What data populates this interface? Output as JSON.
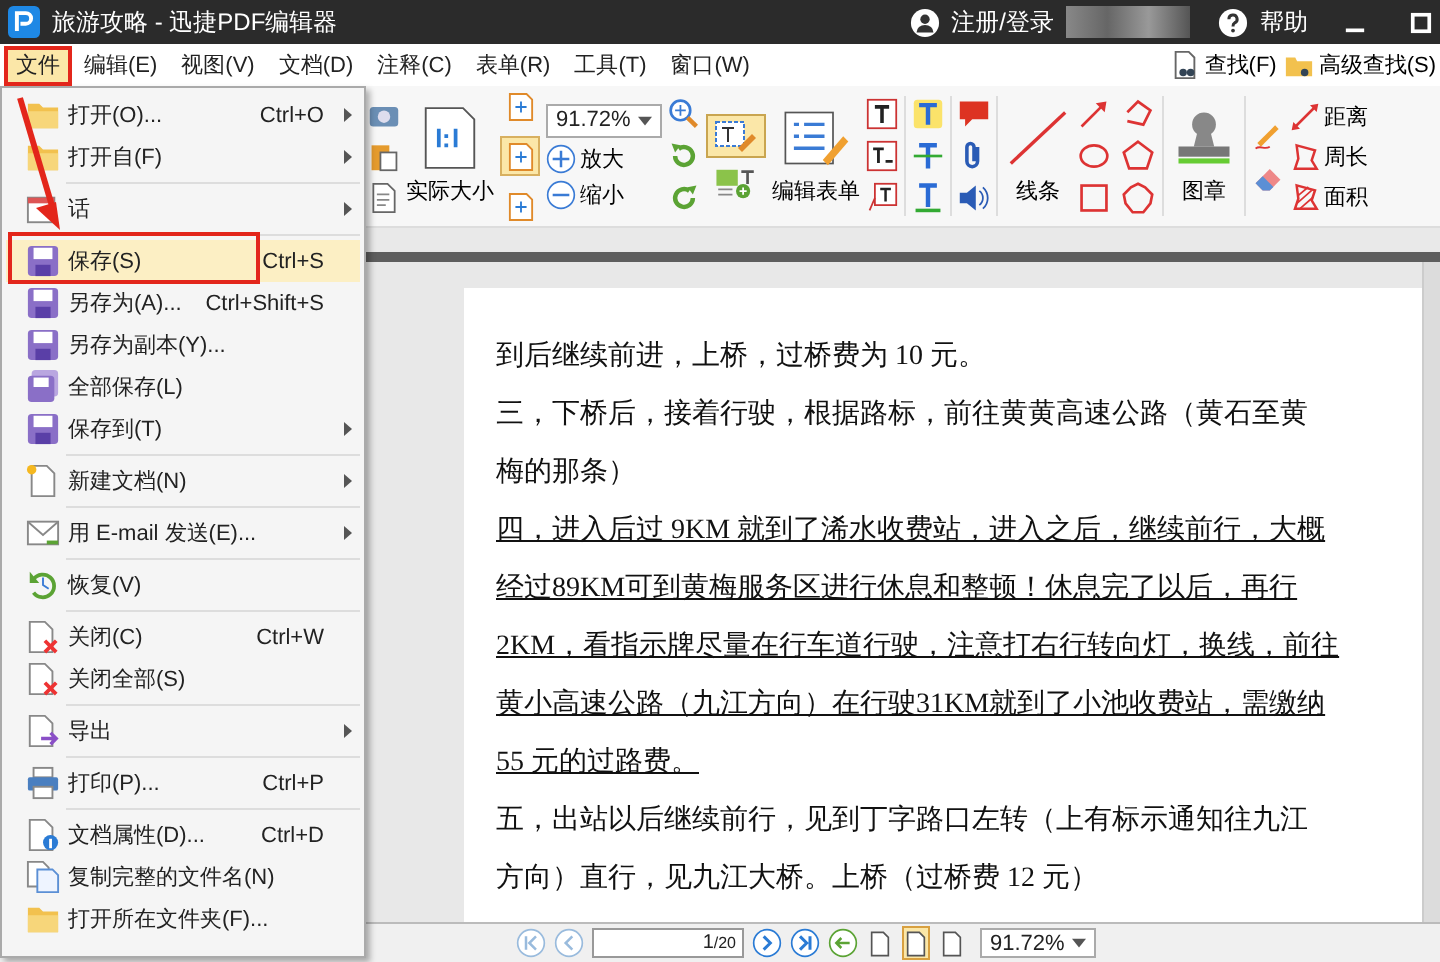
{
  "window": {
    "title": "旅游攻略 - 迅捷PDF编辑器",
    "login": "注册/登录",
    "help": "帮助"
  },
  "menubar": [
    {
      "label": "文件",
      "selected": true
    },
    {
      "label": "编辑(E)",
      "selected": false
    },
    {
      "label": "视图(V)",
      "selected": false
    },
    {
      "label": "文档(D)",
      "selected": false
    },
    {
      "label": "注释(C)",
      "selected": false
    },
    {
      "label": "表单(R)",
      "selected": false
    },
    {
      "label": "工具(T)",
      "selected": false
    },
    {
      "label": "窗口(W)",
      "selected": false
    }
  ],
  "search": {
    "find": "查找(F)",
    "advanced": "高级查找(S)"
  },
  "toolbar": {
    "actual_size": "实际大小",
    "zoom": "91.72%",
    "zoom_in": "放大",
    "zoom_out": "缩小",
    "fit_buttons": [
      {
        "selected": false
      },
      {
        "selected": true
      },
      {
        "selected": false
      }
    ],
    "edit_tool_selected": true,
    "edit_form": "编辑表单",
    "line": "线条",
    "stamp": "图章",
    "distance": "距离",
    "perimeter": "周长",
    "area": "面积"
  },
  "file_menu": [
    [
      {
        "label": "打开(O)...",
        "shortcut": "Ctrl+O",
        "submenu": true,
        "selected": false
      },
      {
        "label": "打开自(F)",
        "submenu": true,
        "selected": false
      }
    ],
    [
      {
        "label": "话",
        "submenu": true,
        "selected": false
      }
    ],
    [
      {
        "label": "保存(S)",
        "shortcut": "Ctrl+S",
        "submenu": false,
        "selected": true
      },
      {
        "label": "另存为(A)...",
        "shortcut": "Ctrl+Shift+S",
        "submenu": false,
        "selected": false
      },
      {
        "label": "另存为副本(Y)...",
        "submenu": false,
        "selected": false
      },
      {
        "label": "全部保存(L)",
        "submenu": false,
        "selected": false
      },
      {
        "label": "保存到(T)",
        "submenu": true,
        "selected": false
      }
    ],
    [
      {
        "label": "新建文档(N)",
        "submenu": true,
        "selected": false
      }
    ],
    [
      {
        "label": "用 E-mail 发送(E)...",
        "submenu": true,
        "selected": false
      }
    ],
    [
      {
        "label": "恢复(V)",
        "submenu": false,
        "selected": false
      }
    ],
    [
      {
        "label": "关闭(C)",
        "shortcut": "Ctrl+W",
        "submenu": false,
        "selected": false
      },
      {
        "label": "关闭全部(S)",
        "submenu": false,
        "selected": false
      }
    ],
    [
      {
        "label": "导出",
        "submenu": true,
        "selected": false
      }
    ],
    [
      {
        "label": "打印(P)...",
        "shortcut": "Ctrl+P",
        "submenu": false,
        "selected": false
      }
    ],
    [
      {
        "label": "文档属性(D)...",
        "shortcut": "Ctrl+D",
        "submenu": false,
        "selected": false
      },
      {
        "label": "复制完整的文件名(N)",
        "submenu": false,
        "selected": false
      },
      {
        "label": "打开所在文件夹(F)...",
        "submenu": false,
        "selected": false
      }
    ]
  ],
  "document": {
    "lines": [
      {
        "text": "到后继续前进，上桥，过桥费为 10 元。",
        "underline": false
      },
      {
        "text": "三，下桥后，接着行驶，根据路标，前往黄黄高速公路（黄石至黄",
        "underline": false
      },
      {
        "text": "梅的那条）",
        "underline": false
      },
      {
        "text": "四，进入后过 9KM 就到了浠水收费站，进入之后，继续前行，大概",
        "underline": true
      },
      {
        "text": "经过89KM可到黄梅服务区进行休息和整顿！休息完了以后，再行",
        "underline": true
      },
      {
        "text": "2KM，看指示牌尽量在行车道行驶，注意打右行转向灯，换线，前往",
        "underline": true
      },
      {
        "text": "黄小高速公路（九江方向）在行驶31KM就到了小池收费站，需缴纳",
        "underline": true
      },
      {
        "text": "55 元的过路费。",
        "underline": true
      },
      {
        "text": "五，出站以后继续前行，见到丁字路口左转（上有标示通知往九江",
        "underline": false
      },
      {
        "text": "方向）直行，见九江大桥。上桥（过桥费 12 元）",
        "underline": false
      }
    ]
  },
  "statusbar": {
    "page": "1",
    "total": "/20",
    "zoom": "91.72%",
    "layout_buttons": [
      {
        "selected": false
      },
      {
        "selected": true
      },
      {
        "selected": false
      }
    ]
  }
}
